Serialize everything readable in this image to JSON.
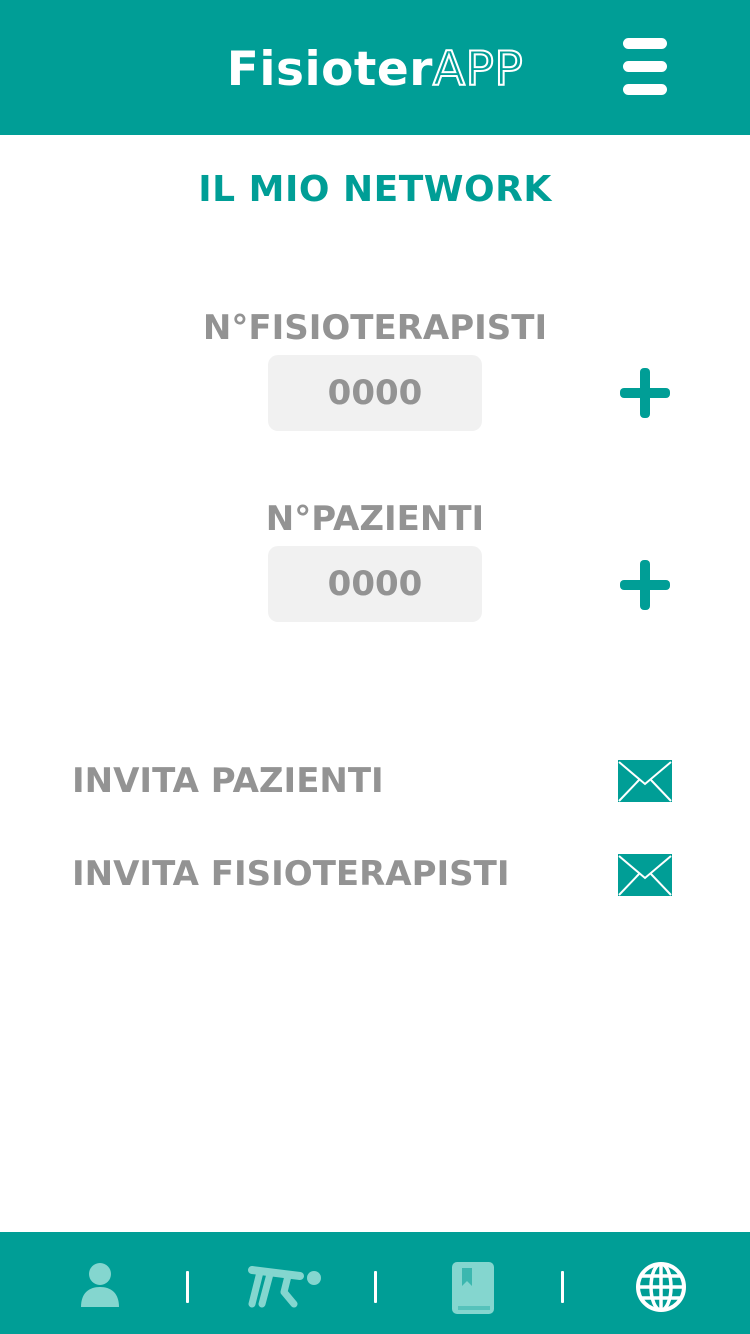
{
  "app": {
    "logo_bold": "Fisioter",
    "logo_outline": "APP"
  },
  "page": {
    "title": "IL MIO NETWORK"
  },
  "counters": {
    "physiotherapists": {
      "label": "N°FISIOTERAPISTI",
      "value": "0000"
    },
    "patients": {
      "label": "N°PAZIENTI",
      "value": "0000"
    }
  },
  "invites": {
    "patients_label": "INVITA PAZIENTI",
    "physiotherapists_label": "INVITA FISIOTERAPISTI"
  },
  "bottom_nav": {
    "items": [
      {
        "icon": "user-icon",
        "active": false
      },
      {
        "icon": "exercise-icon",
        "active": false
      },
      {
        "icon": "bookmark-book-icon",
        "active": false
      },
      {
        "icon": "globe-icon",
        "active": true
      }
    ]
  },
  "colors": {
    "primary": "#009e96",
    "text_gray": "#939393",
    "box_bg": "#f1f1f1",
    "inactive_icon": "#84d6cf",
    "white": "#ffffff"
  }
}
